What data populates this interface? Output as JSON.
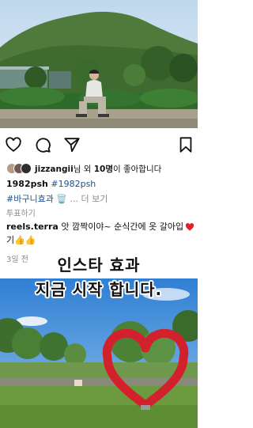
{
  "post": {
    "likes": {
      "username": "jizzangii",
      "suffix_text": "님 외 ",
      "count_text": "10명",
      "tail_text": "이 좋아합니다"
    },
    "caption": {
      "username": "1982psh",
      "hashtag": "#1982psh"
    },
    "second_line": {
      "hashtag": "#바구니효과",
      "emoji": "🗑️",
      "more": "... 더 보기"
    },
    "translate": "투표하기",
    "comment": {
      "username": "reels.terra",
      "text": " 앗 깜짝이야~ 순식간에 옷 갈아입기",
      "emoji": "👍👍"
    },
    "time": "3일 전"
  },
  "banner": {
    "line1": "인스타 효과",
    "line2": "지금 시작 합니다."
  },
  "colors": {
    "tag_blue": "#1d4f91",
    "heart_red": "#e0202e"
  },
  "icons": [
    "heart-outline-icon",
    "comment-icon",
    "share-icon",
    "bookmark-icon",
    "heart-filled-icon"
  ]
}
